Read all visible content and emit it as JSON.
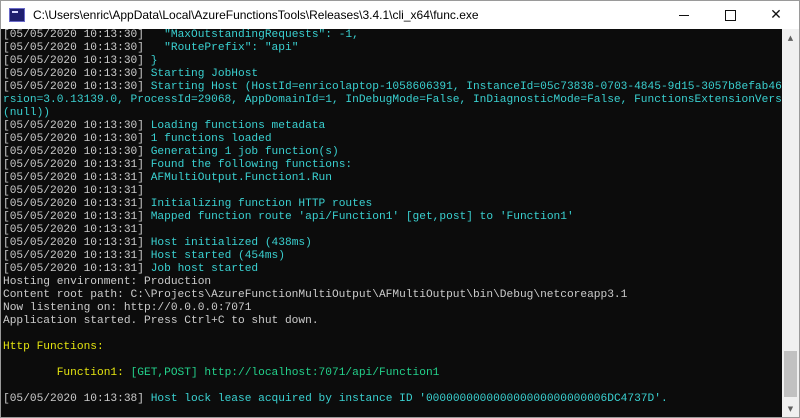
{
  "window": {
    "title": "C:\\Users\\enric\\AppData\\Local\\AzureFunctionsTools\\Releases\\3.4.1\\cli_x64\\func.exe",
    "minimize_icon": "minimize-icon",
    "maximize_icon": "maximize-icon",
    "close_icon": "close-icon",
    "close_glyph": "✕"
  },
  "console": {
    "lines": [
      {
        "ts": "[05/05/2020 10:13:30]",
        "text": "   \"MaxOutstandingRequests\": -1,",
        "color": "c"
      },
      {
        "ts": "[05/05/2020 10:13:30]",
        "text": "   \"RoutePrefix\": \"api\"",
        "color": "c"
      },
      {
        "ts": "[05/05/2020 10:13:30]",
        "text": " }",
        "color": "c"
      },
      {
        "ts": "[05/05/2020 10:13:30]",
        "text": " Starting JobHost",
        "color": "c"
      },
      {
        "ts": "[05/05/2020 10:13:30]",
        "text": " Starting Host (HostId=enricolaptop-1058606391, InstanceId=05c73838-0703-4845-9d15-3057b8efab46, Ve",
        "color": "c"
      },
      {
        "ts": "",
        "text": "rsion=3.0.13139.0, ProcessId=29068, AppDomainId=1, InDebugMode=False, InDiagnosticMode=False, FunctionsExtensionVersion=",
        "color": "c"
      },
      {
        "ts": "",
        "text": "(null))",
        "color": "c"
      },
      {
        "ts": "[05/05/2020 10:13:30]",
        "text": " Loading functions metadata",
        "color": "c"
      },
      {
        "ts": "[05/05/2020 10:13:30]",
        "text": " 1 functions loaded",
        "color": "c"
      },
      {
        "ts": "[05/05/2020 10:13:30]",
        "text": " Generating 1 job function(s)",
        "color": "c"
      },
      {
        "ts": "[05/05/2020 10:13:31]",
        "text": " Found the following functions:",
        "color": "c"
      },
      {
        "ts": "[05/05/2020 10:13:31]",
        "text": " AFMultiOutput.Function1.Run",
        "color": "c"
      },
      {
        "ts": "[05/05/2020 10:13:31]",
        "text": "",
        "color": "c"
      },
      {
        "ts": "[05/05/2020 10:13:31]",
        "text": " Initializing function HTTP routes",
        "color": "c"
      },
      {
        "ts": "[05/05/2020 10:13:31]",
        "text": " Mapped function route 'api/Function1' [get,post] to 'Function1'",
        "color": "c"
      },
      {
        "ts": "[05/05/2020 10:13:31]",
        "text": "",
        "color": "c"
      },
      {
        "ts": "[05/05/2020 10:13:31]",
        "text": " Host initialized (438ms)",
        "color": "c"
      },
      {
        "ts": "[05/05/2020 10:13:31]",
        "text": " Host started (454ms)",
        "color": "c"
      },
      {
        "ts": "[05/05/2020 10:13:31]",
        "text": " Job host started",
        "color": "c"
      },
      {
        "ts": "",
        "text": "Hosting environment: Production",
        "color": "w"
      },
      {
        "ts": "",
        "text": "Content root path: C:\\Projects\\AzureFunctionMultiOutput\\AFMultiOutput\\bin\\Debug\\netcoreapp3.1",
        "color": "w"
      },
      {
        "ts": "",
        "text": "Now listening on: http://0.0.0.0:7071",
        "color": "w"
      },
      {
        "ts": "",
        "text": "Application started. Press Ctrl+C to shut down.",
        "color": "w"
      },
      {
        "ts": "",
        "text": "",
        "color": "w"
      },
      {
        "ts": "",
        "text": "Http Functions:",
        "color": "y"
      },
      {
        "ts": "",
        "text": "",
        "color": "w"
      },
      {
        "ts": "",
        "text": "        Function1: ",
        "color": "y",
        "method": "[GET,POST] ",
        "url": "http://localhost:7071/api/Function1"
      },
      {
        "ts": "",
        "text": "",
        "color": "w"
      },
      {
        "ts": "[05/05/2020 10:13:38]",
        "text": " Host lock lease acquired by instance ID '000000000000000000000000006DC4737D'.",
        "color": "c"
      }
    ]
  },
  "colors": {
    "background": "#0c0c0c",
    "timestamp": "#cccccc",
    "cyan": "#3ad1d1",
    "yellow": "#e5e510",
    "green": "#23d18b"
  }
}
